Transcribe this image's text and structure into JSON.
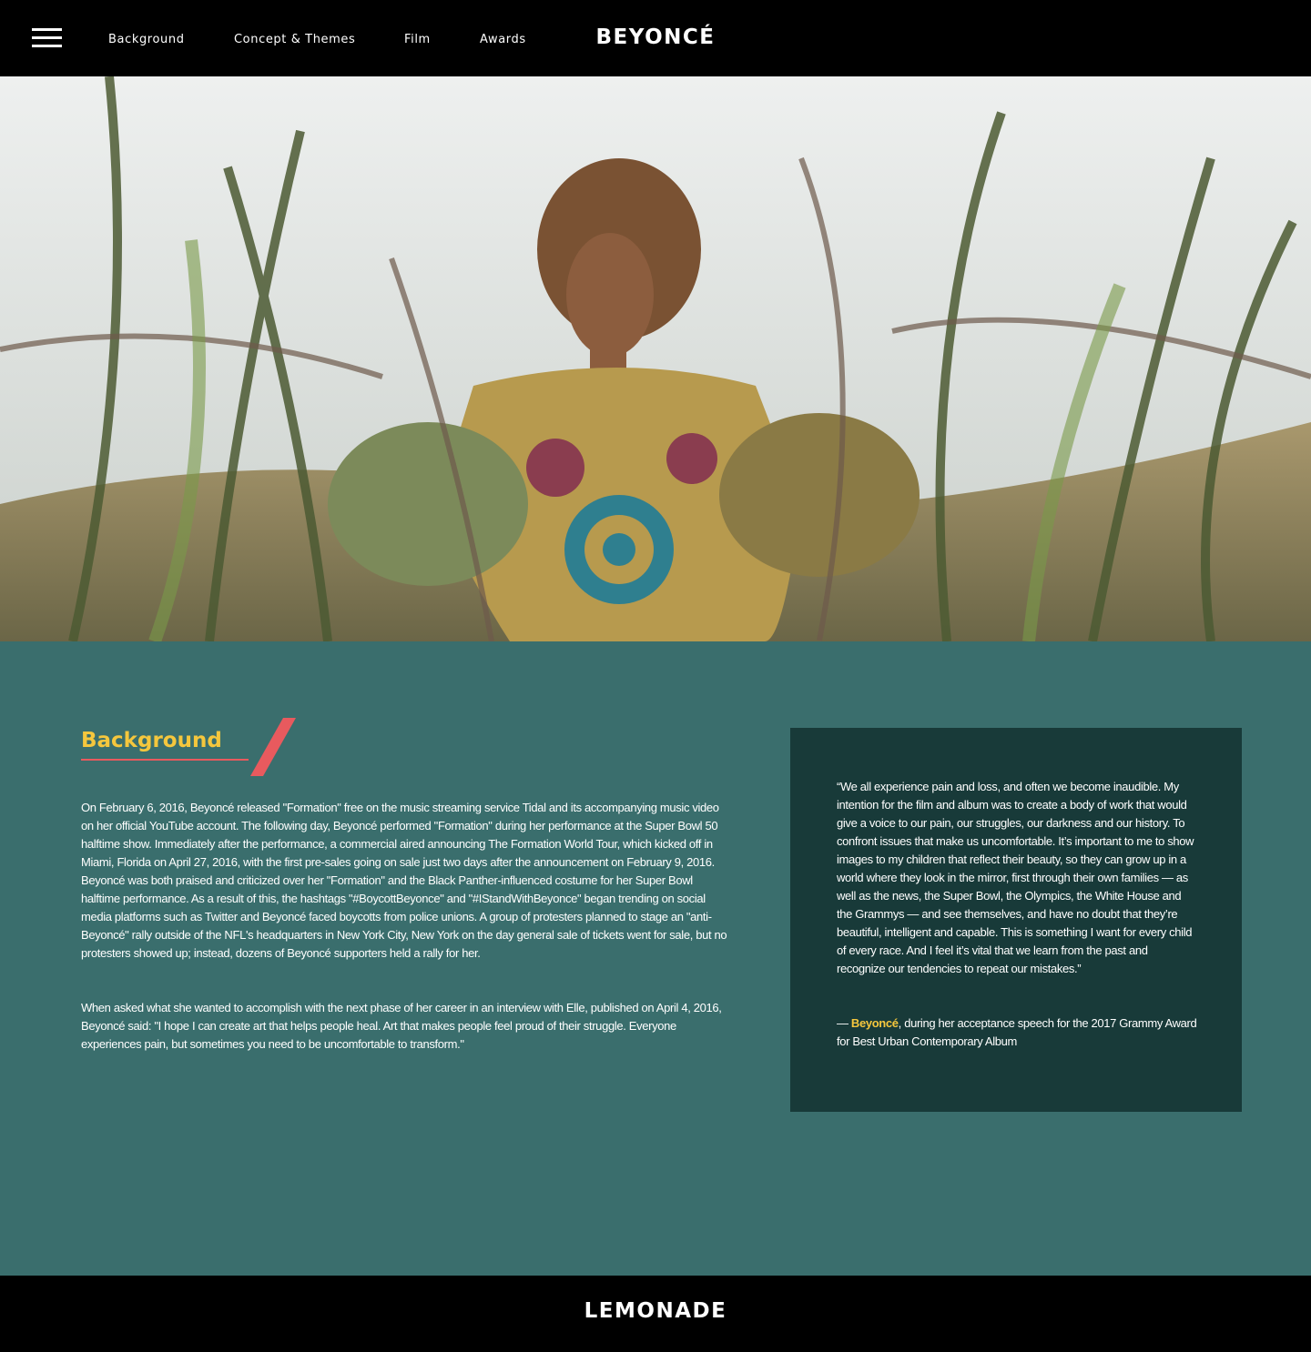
{
  "nav": {
    "menu_icon": "hamburger-menu-icon",
    "links": [
      "Background",
      "Concept & Themes",
      "Film",
      "Awards"
    ],
    "brand": "BEYONCÉ"
  },
  "hero": {
    "image": "photo of a woman in a patterned dress standing among tall grasses"
  },
  "background": {
    "heading": "Background",
    "paragraphs": [
      "On February 6, 2016, Beyoncé released \"Formation\" free on the music streaming service Tidal and its accompanying music video on her official YouTube account. The following day, Beyoncé performed \"Formation\" during her performance at the Super Bowl 50 halftime show. Immediately after the performance, a commercial aired announcing The Formation World Tour, which kicked off in Miami, Florida on April 27, 2016, with the first pre-sales going on sale just two days after the announcement on February 9, 2016. Beyoncé was both praised and criticized over her \"Formation\" and the Black Panther-influenced costume for her Super Bowl halftime performance. As a result of this, the hashtags \"#BoycottBeyonce\" and \"#IStandWithBeyonce\" began trending on social media platforms such as Twitter and Beyoncé faced boycotts from police unions. A group of protesters planned to stage an \"anti-Beyoncé\" rally outside of the NFL's headquarters in New York City, New York on the day general sale of tickets went for sale, but no protesters showed up; instead, dozens of Beyoncé supporters held a rally for her.",
      "When asked what she wanted to accomplish with the next phase of her career in an interview with Elle, published on April 4, 2016, Beyoncé said: \"I hope I can create art that helps people heal. Art that makes people feel proud of their struggle. Everyone experiences pain, but sometimes you need to be uncomfortable to transform.\""
    ]
  },
  "quote": {
    "text": "“We all experience pain and loss, and often we become inaudible. My intention for the film and album was to create a body of work that would give a voice to our pain, our struggles, our darkness and our history. To confront issues that make us uncomfortable. It’s important to me to show images to my children that reflect their beauty, so they can grow up in a world where they look in the mirror, first through their own families — as well as the news, the Super Bowl, the Olympics, the White House and the Grammys — and see themselves, and have no doubt that they’re beautiful, intelligent and capable. This is something I want for every child of every race. And I feel it’s vital that we learn from the past and recognize our tendencies to repeat our mistakes.”",
    "dash": "— ",
    "author": "Beyoncé",
    "attribution": ", during her acceptance speech for the 2017 Grammy Award for Best Urban Contemporary Album"
  },
  "footer": {
    "title": "LEMONADE"
  },
  "colors": {
    "nav_bg": "#000000",
    "content_bg": "#3a6e6d",
    "quote_bg": "#183a39",
    "accent_yellow": "#f5c73d",
    "accent_red": "#e85a5e"
  }
}
